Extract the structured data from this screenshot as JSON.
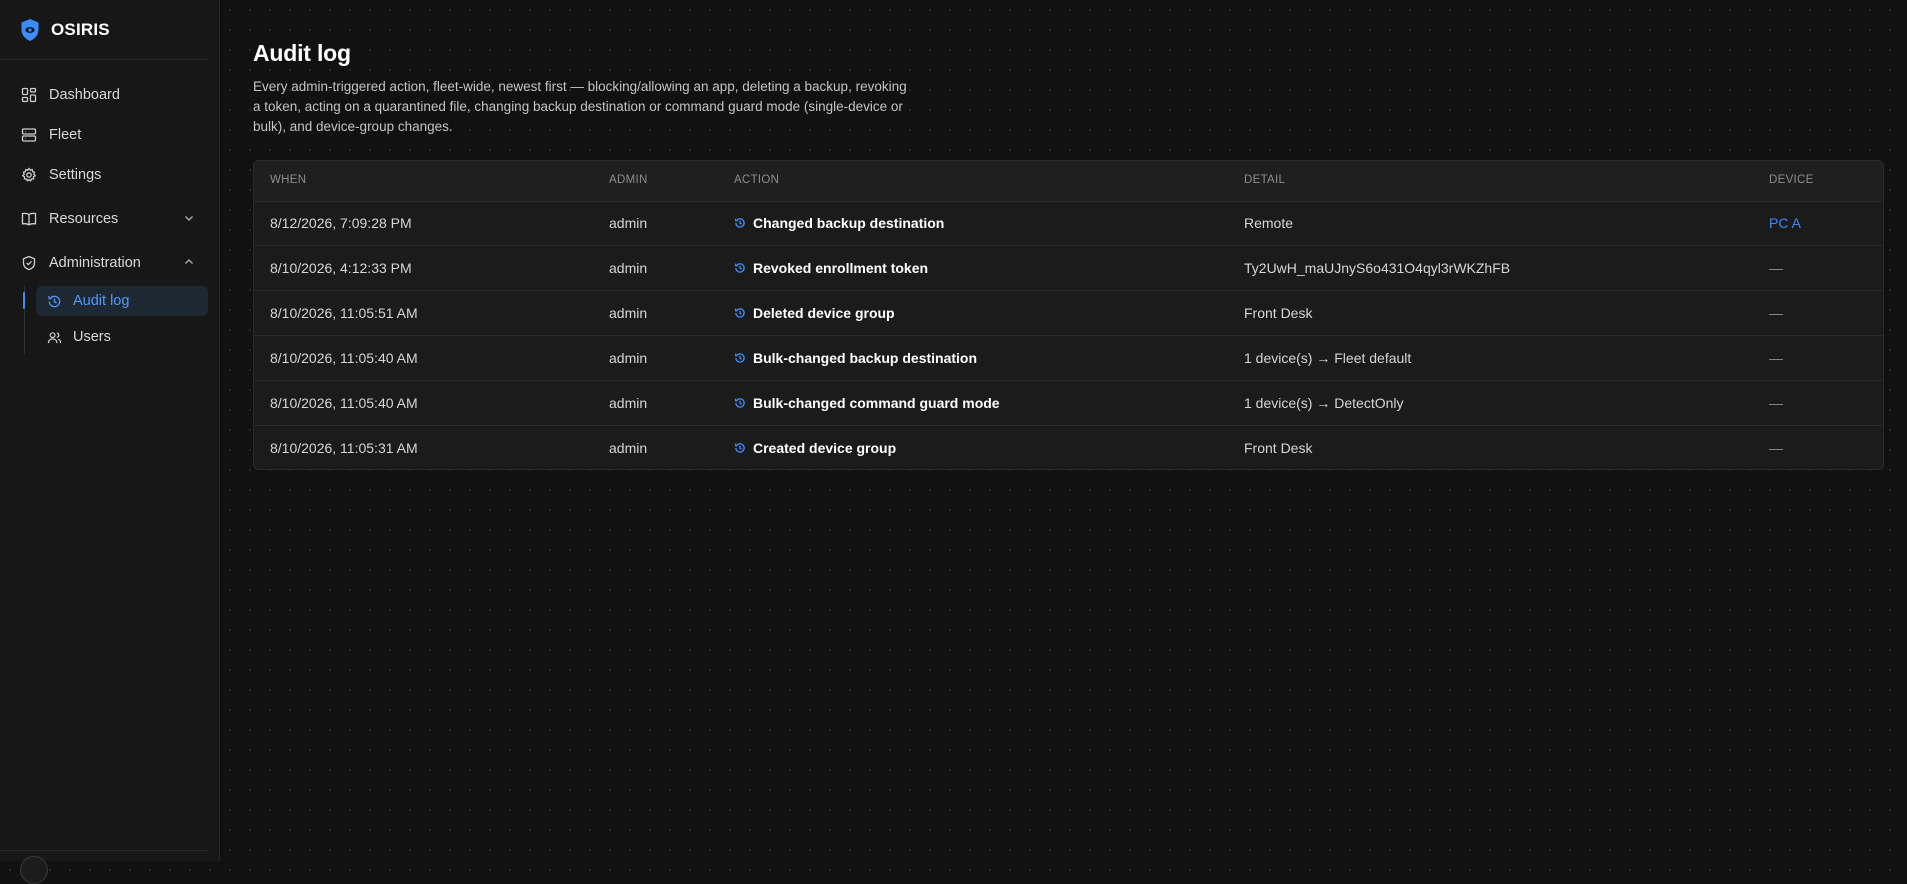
{
  "brand": {
    "name": "OSIRIS",
    "accent": "#3b8cff"
  },
  "sidebar": {
    "items": [
      {
        "label": "Dashboard",
        "icon": "dashboard-icon"
      },
      {
        "label": "Fleet",
        "icon": "server-icon"
      },
      {
        "label": "Settings",
        "icon": "gear-icon"
      },
      {
        "label": "Resources",
        "icon": "book-icon",
        "expanded": false
      },
      {
        "label": "Administration",
        "icon": "shield-check-icon",
        "expanded": true
      }
    ],
    "subitems": [
      {
        "label": "Audit log",
        "icon": "history-icon",
        "active": true
      },
      {
        "label": "Users",
        "icon": "users-icon",
        "active": false
      }
    ]
  },
  "page": {
    "title": "Audit log",
    "description": "Every admin-triggered action, fleet-wide, newest first — blocking/allowing an app, deleting a backup, revoking a token, acting on a quarantined file, changing backup destination or command guard mode (single-device or bulk), and device-group changes."
  },
  "table": {
    "headers": {
      "when": "WHEN",
      "admin": "ADMIN",
      "action": "ACTION",
      "detail": "DETAIL",
      "device": "DEVICE"
    },
    "rows": [
      {
        "when": "8/12/2026, 7:09:28 PM",
        "admin": "admin",
        "action": "Changed backup destination",
        "detail": "Remote",
        "device": "PC A"
      },
      {
        "when": "8/10/2026, 4:12:33 PM",
        "admin": "admin",
        "action": "Revoked enrollment token",
        "detail": "Ty2UwH_maUJnyS6o431O4qyl3rWKZhFB",
        "device": "—"
      },
      {
        "when": "8/10/2026, 11:05:51 AM",
        "admin": "admin",
        "action": "Deleted device group",
        "detail": "Front Desk",
        "device": "—"
      },
      {
        "when": "8/10/2026, 11:05:40 AM",
        "admin": "admin",
        "action": "Bulk-changed backup destination",
        "detail": "1 device(s) → Fleet default",
        "device": "—"
      },
      {
        "when": "8/10/2026, 11:05:40 AM",
        "admin": "admin",
        "action": "Bulk-changed command guard mode",
        "detail": "1 device(s) → DetectOnly",
        "device": "—"
      },
      {
        "when": "8/10/2026, 11:05:31 AM",
        "admin": "admin",
        "action": "Created device group",
        "detail": "Front Desk",
        "device": "—"
      }
    ]
  }
}
